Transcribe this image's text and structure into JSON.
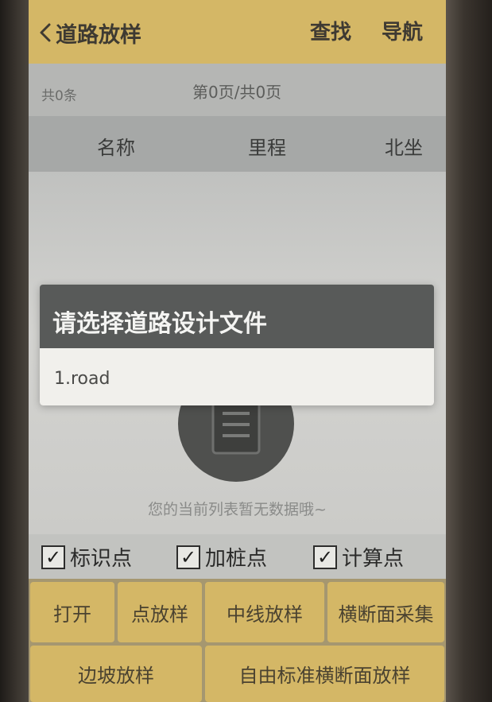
{
  "header": {
    "title": "道路放样",
    "back_icon": "chevron-left-icon",
    "search_label": "查找",
    "navigate_label": "导航"
  },
  "pager": {
    "count": "共0条",
    "page": "第0页/共0页"
  },
  "table": {
    "columns": [
      "名称",
      "里程",
      "北坐"
    ]
  },
  "empty": {
    "icon": "document-icon",
    "message": "您的当前列表暂无数据哦~"
  },
  "dialog": {
    "title": "请选择道路设计文件",
    "items": [
      "1.road"
    ]
  },
  "checkboxes": [
    {
      "label": "标识点",
      "checked": true
    },
    {
      "label": "加桩点",
      "checked": true
    },
    {
      "label": "计算点",
      "checked": true
    }
  ],
  "buttons": {
    "open": "打开",
    "point_stakeout": "点放样",
    "centerline_stakeout": "中线放样",
    "cross_section_collect": "横断面采集",
    "slope_stakeout": "边坡放样",
    "free_std_cross_section": "自由标准横断面放样"
  },
  "colors": {
    "accent": "#d4b766",
    "dialog_header": "#585a59",
    "dialog_item": "#f1f0ec"
  }
}
